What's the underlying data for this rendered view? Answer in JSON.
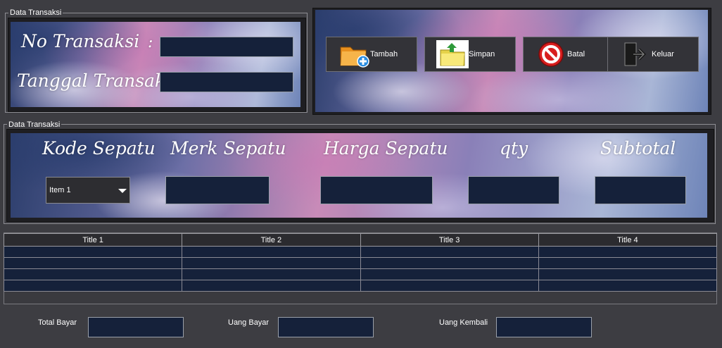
{
  "transaction_header": {
    "group_title": "Data Transaksi",
    "no_label": "No Transaksi",
    "no_colon": ":",
    "no_value": "",
    "date_label": "Tanggal Transaksi :",
    "date_value": ""
  },
  "toolbar": {
    "add_label": "Tambah",
    "save_label": "Simpan",
    "cancel_label": "Batal",
    "exit_label": "Keluar"
  },
  "items": {
    "group_title": "Data Transaksi",
    "code_label": "Kode Sepatu",
    "brand_label": "Merk Sepatu",
    "price_label": "Harga Sepatu",
    "qty_label": "qty",
    "subtotal_label": "Subtotal",
    "code_selected": "Item 1",
    "brand_value": "",
    "price_value": "",
    "qty_value": "",
    "subtotal_value": ""
  },
  "table": {
    "columns": [
      "Title 1",
      "Title 2",
      "Title 3",
      "Title 4"
    ],
    "rows": [
      [
        "",
        "",
        "",
        ""
      ],
      [
        "",
        "",
        "",
        ""
      ],
      [
        "",
        "",
        "",
        ""
      ],
      [
        "",
        "",
        "",
        ""
      ]
    ]
  },
  "footer": {
    "total_label": "Total Bayar",
    "paid_label": "Uang Bayar",
    "change_label": "Uang Kembali",
    "total_value": "",
    "paid_value": "",
    "change_value": ""
  },
  "icons": {
    "add": "folder-add-icon",
    "save": "folder-save-icon",
    "cancel": "cancel-icon",
    "exit": "exit-icon"
  }
}
